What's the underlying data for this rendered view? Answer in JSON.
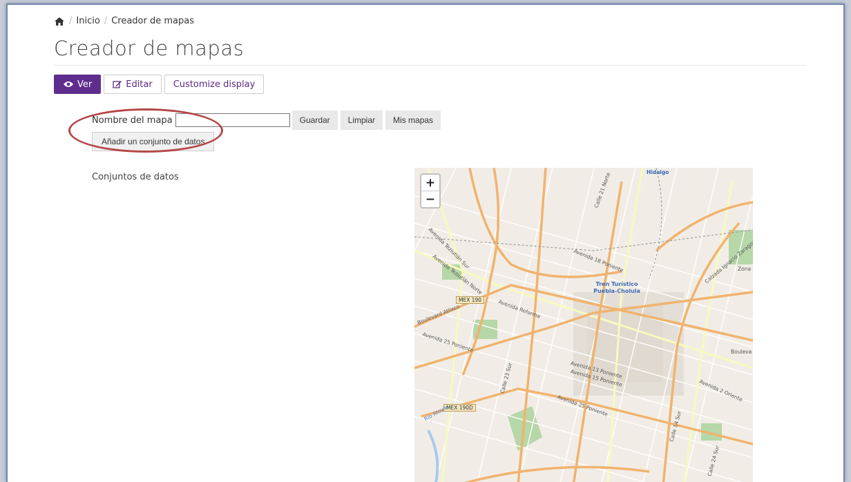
{
  "breadcrumb": {
    "home_icon": "home-icon",
    "items": [
      "Inicio",
      "Creador de mapas"
    ]
  },
  "page": {
    "title": "Creador de mapas"
  },
  "tabs": [
    {
      "label": "Ver",
      "icon": "eye-icon",
      "active": true
    },
    {
      "label": "Editar",
      "icon": "edit-icon",
      "active": false
    },
    {
      "label": "Customize display",
      "active": false
    }
  ],
  "form": {
    "name_label": "Nombre del mapa",
    "name_value": "",
    "buttons": [
      "Guardar",
      "Limpiar",
      "Mis mapas"
    ],
    "add_dataset": "Añadir un conjunto de datos"
  },
  "datasets": {
    "label": "Conjuntos de datos"
  },
  "map": {
    "zoom_in": "+",
    "zoom_out": "−",
    "labels": {
      "hidalgo": "Hidalgo",
      "tren": "Tren Turístico Puebla-Cholula",
      "mex190": "MEX 190",
      "mex190d": "MEX 190D",
      "av_reforma": "Avenida Reforma",
      "av_25_poniente": "Avenida 25 Poniente",
      "av_25_poniente_2": "Avenida 25 Poniente",
      "blvd_atlixco": "Boulevard Atlixco",
      "av_18_poniente": "Avenida 18 Poniente",
      "av_2_oriente": "Avenida 2 Oriente",
      "calle_21_norte": "Calle 21 Norte",
      "calle_23_sur": "Calle 23 Sur",
      "calle_14_sur": "Calle 14 Sur",
      "calle_24_sur": "Calle 24 Sur",
      "zona": "Zona de los",
      "av_zaragoza": "Calzada Ignacio Zaragoza",
      "av_13_poniente": "Avenida 13 Poniente",
      "av_15_poniente": "Avenida 15 Poniente",
      "av_teziutlan": "Avenida Teziutlán Norte",
      "av_teziutlan_sur": "Avenida Teziutlán Sur",
      "rio": "Río Atoyac",
      "boulevard": "Bouleva"
    }
  },
  "colors": {
    "accent": "#5f2d8e",
    "circle": "#b5484a"
  }
}
